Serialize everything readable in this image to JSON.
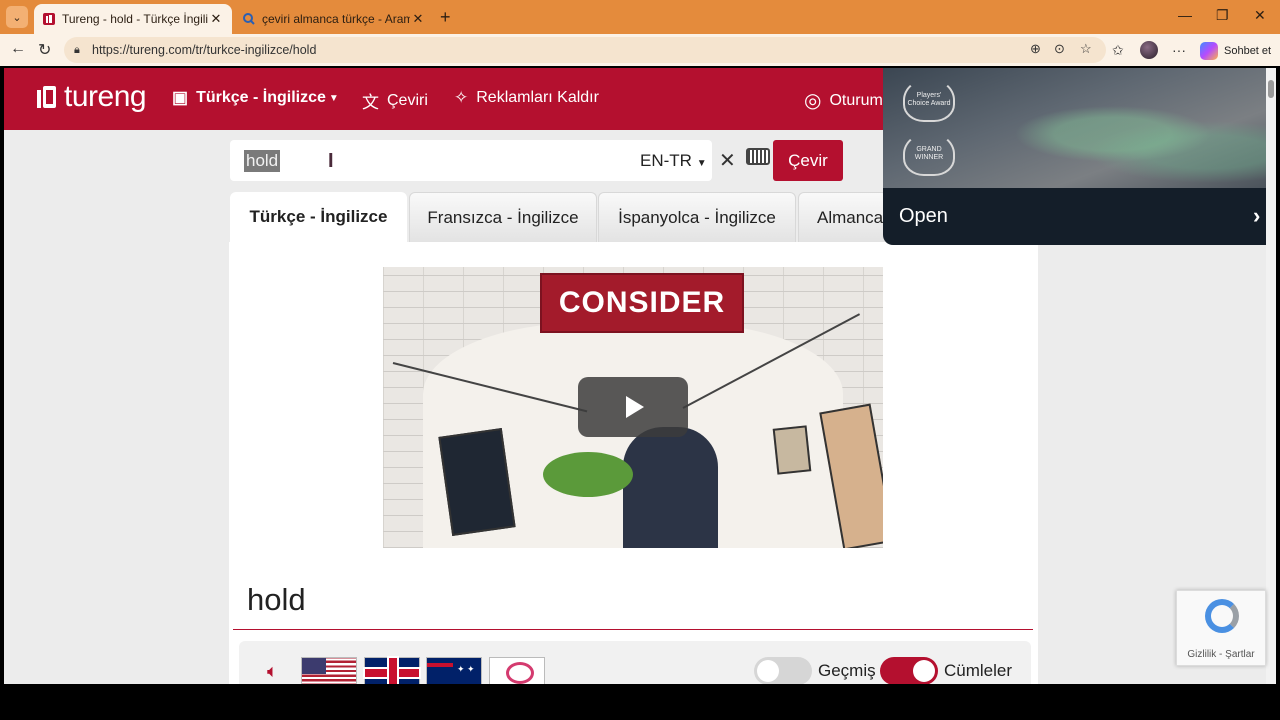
{
  "browser": {
    "tabs": [
      {
        "title": "Tureng - hold - Türkçe İngilizce Sö",
        "active": true
      },
      {
        "title": "çeviri almanca türkçe - Arama",
        "active": false
      }
    ],
    "new_tab": "+",
    "url": "https://tureng.com/tr/turkce-ingilizce/hold",
    "copilot_label": "Sohbet et",
    "window_controls": [
      "—",
      "❐",
      "✕"
    ]
  },
  "site": {
    "logo_text": "tureng",
    "nav": [
      {
        "label": "Türkçe - İngilizce",
        "icon": "dictionary-icon"
      },
      {
        "label": "Çeviri",
        "icon": "translate-icon"
      },
      {
        "label": "Reklamları Kaldır",
        "icon": "sparkle-icon"
      },
      {
        "label": "Oturum",
        "icon": "user-icon"
      }
    ],
    "brand_color": "#b4102f"
  },
  "search": {
    "value": "hold",
    "lang_pair": "EN-TR",
    "clear": "✕",
    "submit_label": "Çevir"
  },
  "dict_tabs": [
    "Türkçe - İngilizce",
    "Fransızca - İngilizce",
    "İspanyolca - İngilizce",
    "Almanca"
  ],
  "video": {
    "banner": "CONSIDER"
  },
  "word": {
    "title": "hold"
  },
  "options": {
    "history_label": "Geçmiş",
    "history_on": false,
    "sentences_label": "Cümleler",
    "sentences_on": true
  },
  "ad": {
    "badge1": "Players' Choice Award",
    "badge2": "GRAND WINNER",
    "cta": "Open",
    "chevron": "›"
  },
  "recaptcha": {
    "text": "Gizlilik - Şartlar"
  }
}
